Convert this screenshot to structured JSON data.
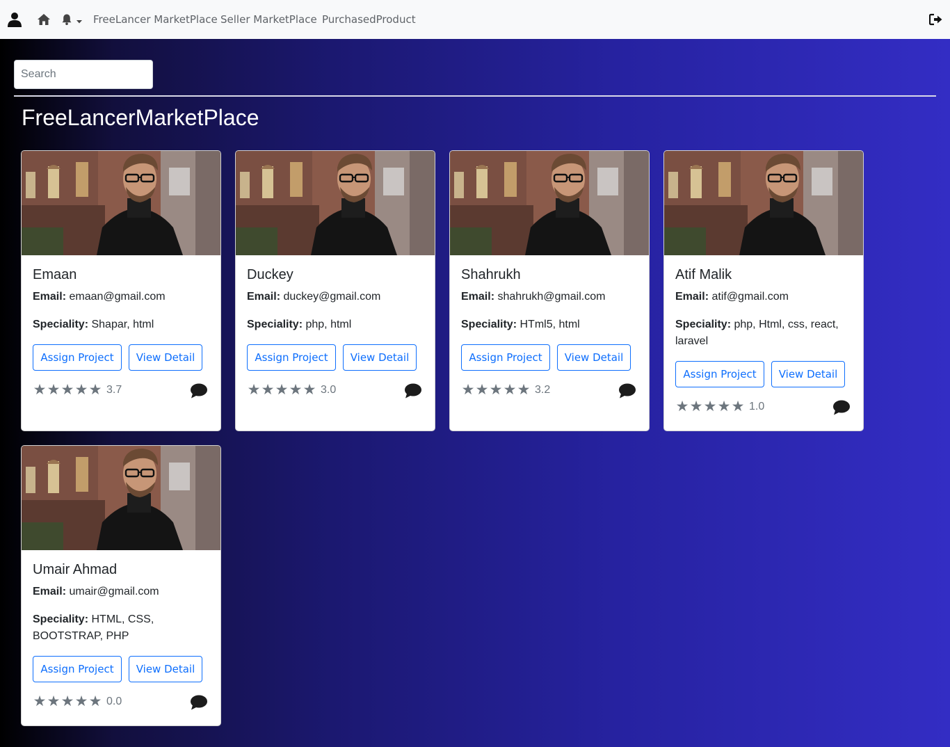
{
  "nav": {
    "links": [
      "FreeLancer MarketPlace",
      "Seller MarketPlace",
      "PurchasedProduct"
    ]
  },
  "search": {
    "placeholder": "Search"
  },
  "page_title": "FreeLancerMarketPlace",
  "labels": {
    "email": "Email:",
    "speciality": "Speciality:",
    "assign": "Assign Project",
    "detail": "View Detail"
  },
  "cards": [
    {
      "name": "Emaan",
      "email": "emaan@gmail.com",
      "speciality": "Shapar, html",
      "rating": "3.7"
    },
    {
      "name": "Duckey",
      "email": "duckey@gmail.com",
      "speciality": "php, html",
      "rating": "3.0"
    },
    {
      "name": "Shahrukh",
      "email": "shahrukh@gmail.com",
      "speciality": "HTml5, html",
      "rating": "3.2"
    },
    {
      "name": "Atif Malik",
      "email": "atif@gmail.com",
      "speciality": "php, Html, css, react, laravel",
      "rating": "1.0"
    },
    {
      "name": "Umair Ahmad",
      "email": "umair@gmail.com",
      "speciality": "HTML, CSS, BOOTSTRAP, PHP",
      "rating": "0.0"
    }
  ],
  "colors": {
    "primary": "#0d6efd",
    "navbar_bg": "#f8f9fa",
    "star": "#6c757d"
  },
  "icons": {
    "user": "user-icon",
    "home": "home-icon",
    "bell": "bell-icon",
    "logout": "logout-icon",
    "chat": "chat-bubble-icon",
    "star": "star-icon"
  }
}
